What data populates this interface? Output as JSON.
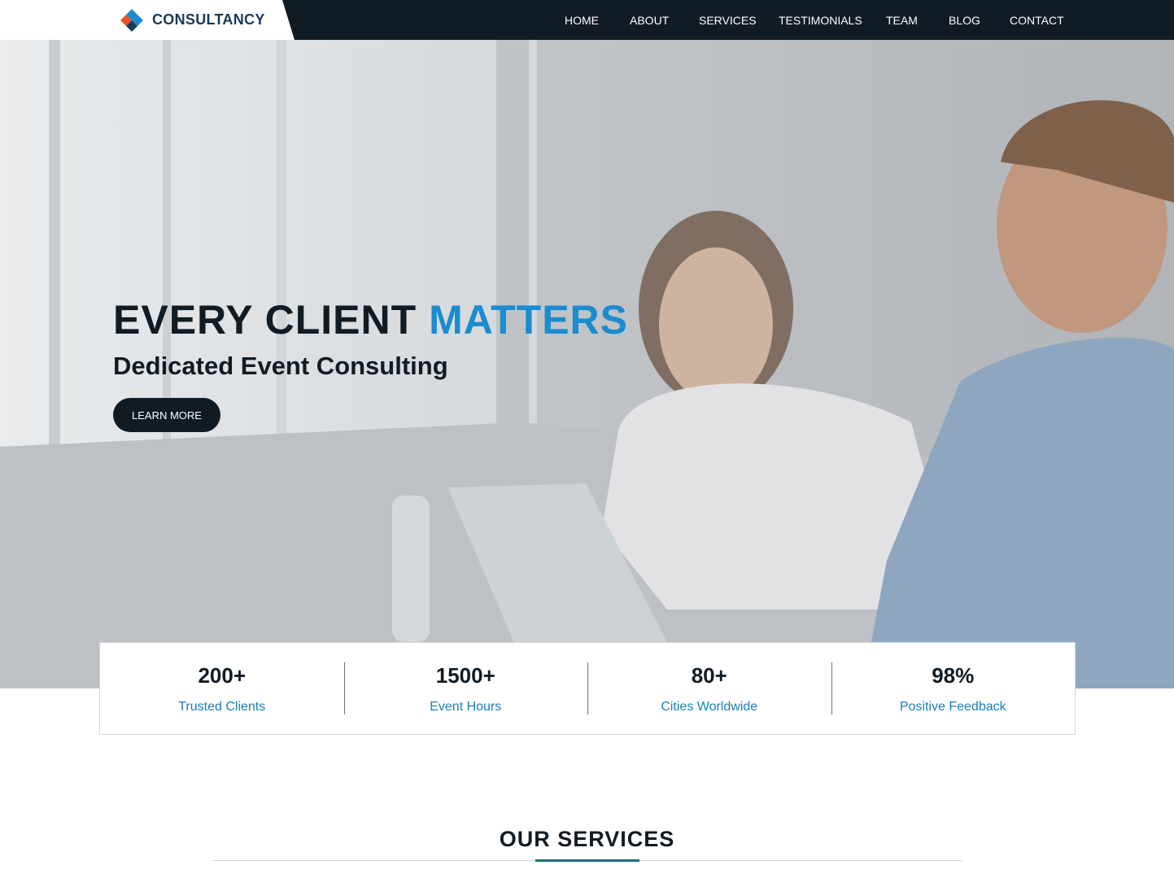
{
  "brand": {
    "name": "CONSULTANCY",
    "logo_icon": "diamond-logo-icon",
    "colors": {
      "orange": "#e8532b",
      "blue": "#1a8ccf",
      "navy": "#1a3a5a"
    }
  },
  "nav": {
    "items": [
      {
        "label": "HOME"
      },
      {
        "label": "ABOUT"
      },
      {
        "label": "SERVICES"
      },
      {
        "label": "TESTIMONIALS"
      },
      {
        "label": "TEAM"
      },
      {
        "label": "BLOG"
      },
      {
        "label": "CONTACT"
      }
    ]
  },
  "hero": {
    "title_plain": "EVERY CLIENT ",
    "title_accent": "MATTERS",
    "subtitle": "Dedicated Event Consulting",
    "button_label": "LEARN MORE",
    "accent_color": "#1a8ccf"
  },
  "stats": [
    {
      "value": "200+",
      "label": "Trusted Clients"
    },
    {
      "value": "1500+",
      "label": "Event Hours"
    },
    {
      "value": "80+",
      "label": "Cities Worldwide"
    },
    {
      "value": "98%",
      "label": "Positive Feedback"
    }
  ],
  "services": {
    "title": "OUR SERVICES"
  },
  "theme": {
    "dark": "#111b24",
    "stat_label": "#1a7fb8",
    "section_accent": "#1f6d80"
  }
}
